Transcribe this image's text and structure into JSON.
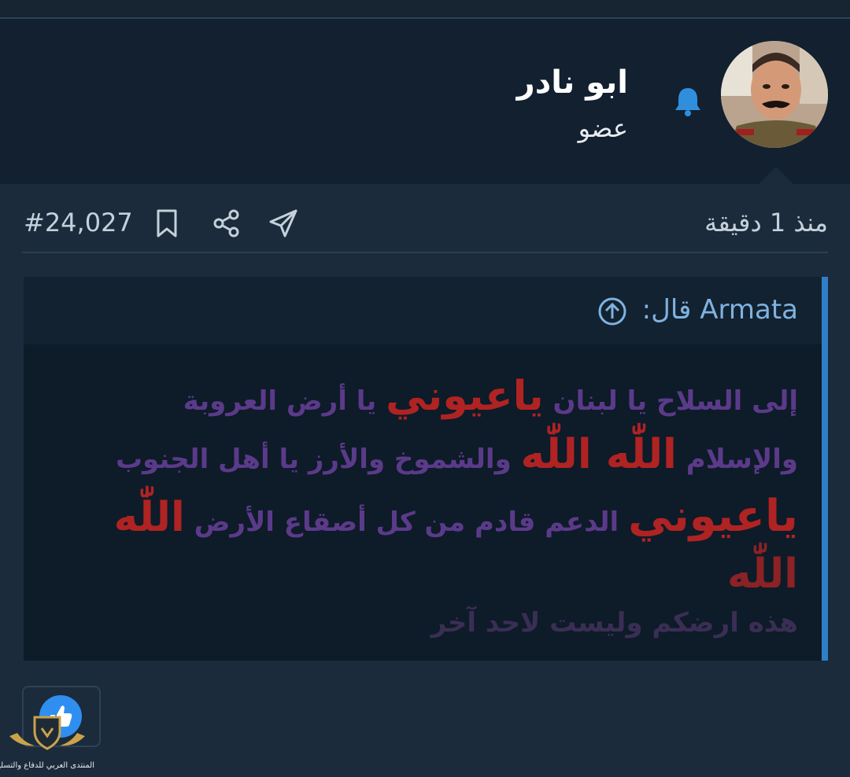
{
  "user": {
    "name": "ابو نادر",
    "role": "عضو"
  },
  "post": {
    "time": "منذ 1 دقيقة",
    "number": "#24,027"
  },
  "quote": {
    "author_line": "Armata قال:",
    "lines": [
      {
        "p1": "إلى السلاح يا لبنان ",
        "r1": "ياعيوني",
        "p2": " يا أرض العروبة"
      },
      {
        "p1": "والإسلام ",
        "r1": "اللّٰه اللّٰه",
        "p2": " والشموخ والأرز يا أهل الجنوب"
      },
      {
        "r1": "ياعيوني",
        "p1": " الدعم قادم من كل أصقاع الأرض ",
        "r2": "اللّٰه"
      },
      {
        "r1": "اللّٰه"
      },
      {
        "p1": "هذه ارضكم وليست لاحد آخر"
      }
    ]
  },
  "watermark": {
    "text": "المنتدى العربي للدفاع والتسليح"
  },
  "colors": {
    "accent": "#2f7fc8",
    "quote_purple": "#5b3a8a",
    "quote_red": "#b02323",
    "bell": "#2f8fdc",
    "like": "#2f8ff0"
  },
  "icons": [
    "bell-icon",
    "bookmark-icon",
    "share-icon",
    "send-icon",
    "arrow-up-circle-icon",
    "thumbs-up-icon"
  ]
}
